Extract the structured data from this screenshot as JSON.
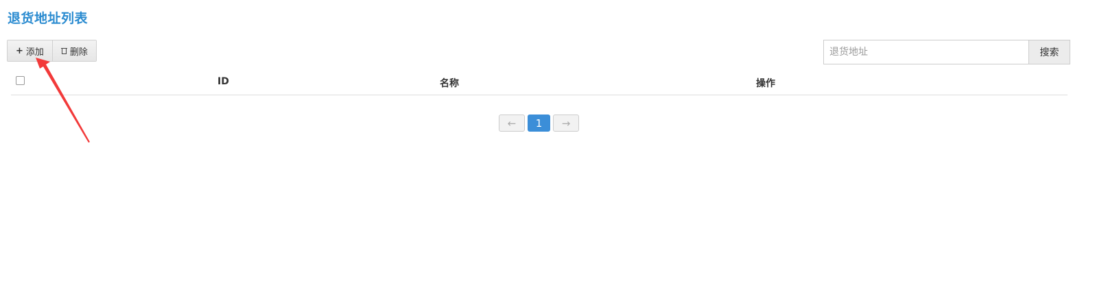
{
  "page": {
    "title": "退货地址列表"
  },
  "toolbar": {
    "add_icon": "plus-icon",
    "add_label": "添加",
    "delete_icon": "trash-icon",
    "delete_label": "删除"
  },
  "search": {
    "placeholder": "退货地址",
    "button_label": "搜索"
  },
  "table": {
    "columns": [
      "ID",
      "名称",
      "操作"
    ],
    "rows": []
  },
  "pagination": {
    "prev": "←",
    "current": "1",
    "next": "→"
  },
  "annotation": {
    "color": "#f23a3a",
    "icon": "red-arrow-icon"
  }
}
